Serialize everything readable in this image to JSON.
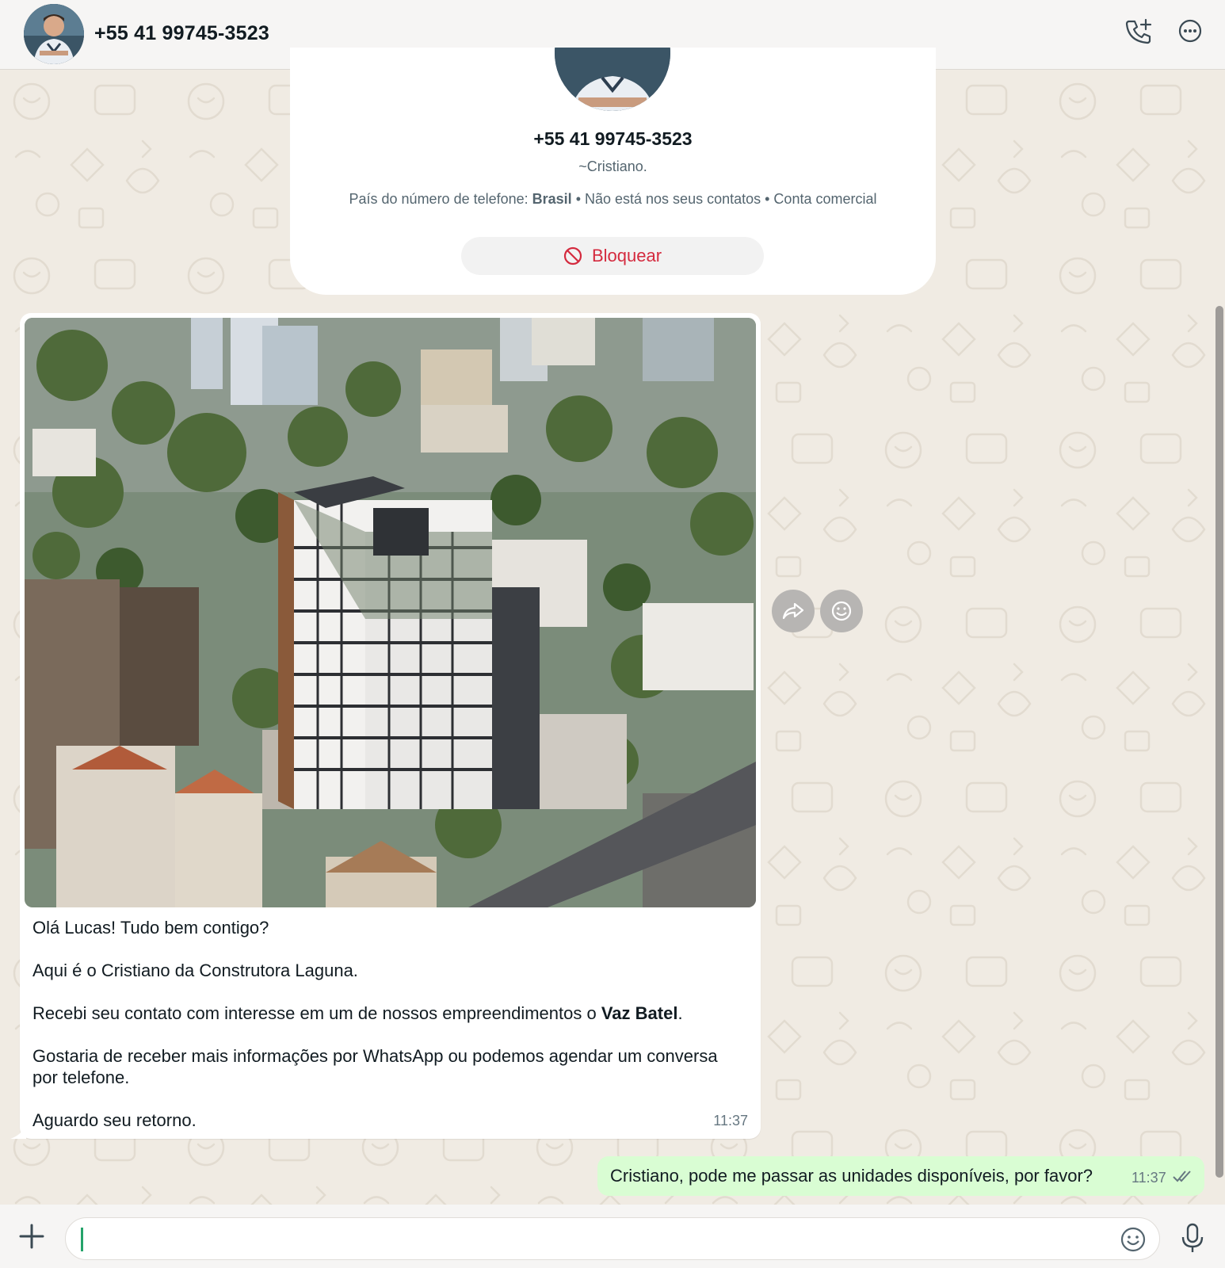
{
  "header": {
    "title": "+55 41 99745-3523",
    "call_icon": "phone-add-icon",
    "menu_icon": "more-options-icon"
  },
  "contact_card": {
    "phone": "+55 41 99745-3523",
    "name": "~Cristiano.",
    "details_prefix": "País do número de telefone: ",
    "country": "Brasil",
    "details_suffix": " • Não está nos seus contatos • Conta comercial",
    "block_label": "Bloquear",
    "block_icon": "block-icon"
  },
  "incoming_message": {
    "image_alt": "aerial-city-photo",
    "lines": [
      "Olá Lucas! Tudo bem contigo?",
      "Aqui é o Cristiano da Construtora Laguna.",
      "Recebi seu contato com interesse em um de nossos empreendimentos o ",
      "Vaz Batel",
      ".",
      "Gostaria de receber mais informações por WhatsApp ou podemos agendar um conversa por telefone.",
      "Aguardo seu retorno."
    ],
    "time": "11:37"
  },
  "outgoing_message": {
    "text": "Cristiano, pode me passar as unidades disponíveis, por favor?",
    "time": "11:37",
    "status_icon": "double-check-icon"
  },
  "composer": {
    "placeholder": "",
    "value": ""
  },
  "colors": {
    "accent_green": "#25a36a",
    "block_red": "#d42a3e",
    "outgoing_bubble": "#d9fdd3",
    "wallpaper": "#f0ebe3"
  }
}
